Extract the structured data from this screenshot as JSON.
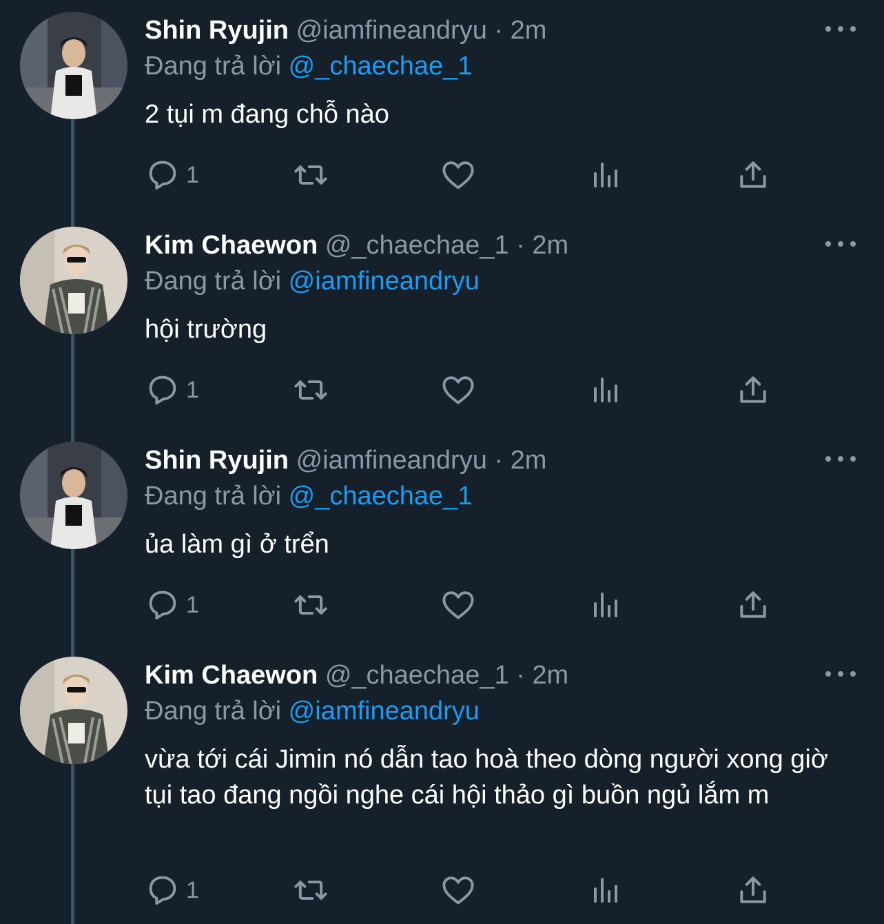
{
  "tweets": [
    {
      "name": "Shin Ryujin",
      "handle": "@iamfineandryu",
      "separator": "·",
      "time": "2m",
      "reply_prefix": "Đang trả lời",
      "reply_to": "@_chaechae_1",
      "text": "2 tụi m đang chỗ nào",
      "reply_count": "1"
    },
    {
      "name": "Kim Chaewon",
      "handle": "@_chaechae_1",
      "separator": "·",
      "time": "2m",
      "reply_prefix": "Đang trả lời",
      "reply_to": "@iamfineandryu",
      "text": "hội trường",
      "reply_count": "1"
    },
    {
      "name": "Shin Ryujin",
      "handle": "@iamfineandryu",
      "separator": "·",
      "time": "2m",
      "reply_prefix": "Đang trả lời",
      "reply_to": "@_chaechae_1",
      "text": "ủa làm gì ở trển",
      "reply_count": "1"
    },
    {
      "name": "Kim Chaewon",
      "handle": "@_chaechae_1",
      "separator": "·",
      "time": "2m",
      "reply_prefix": "Đang trả lời",
      "reply_to": "@iamfineandryu",
      "text": "vừa tới cái Jimin nó dẫn tao hoà theo dòng người xong giờ tụi tao đang ngồi nghe cái hội thảo gì buồn ngủ lắm m",
      "reply_count": "1"
    }
  ],
  "icons": {
    "reply": "reply-icon",
    "retweet": "retweet-icon",
    "like": "heart-icon",
    "views": "views-icon",
    "share": "share-icon",
    "more": "more-icon"
  },
  "colors": {
    "background": "#15202b",
    "muted": "#8b98a5",
    "mention": "#1d9bf0",
    "thread_line": "#3d5466"
  }
}
